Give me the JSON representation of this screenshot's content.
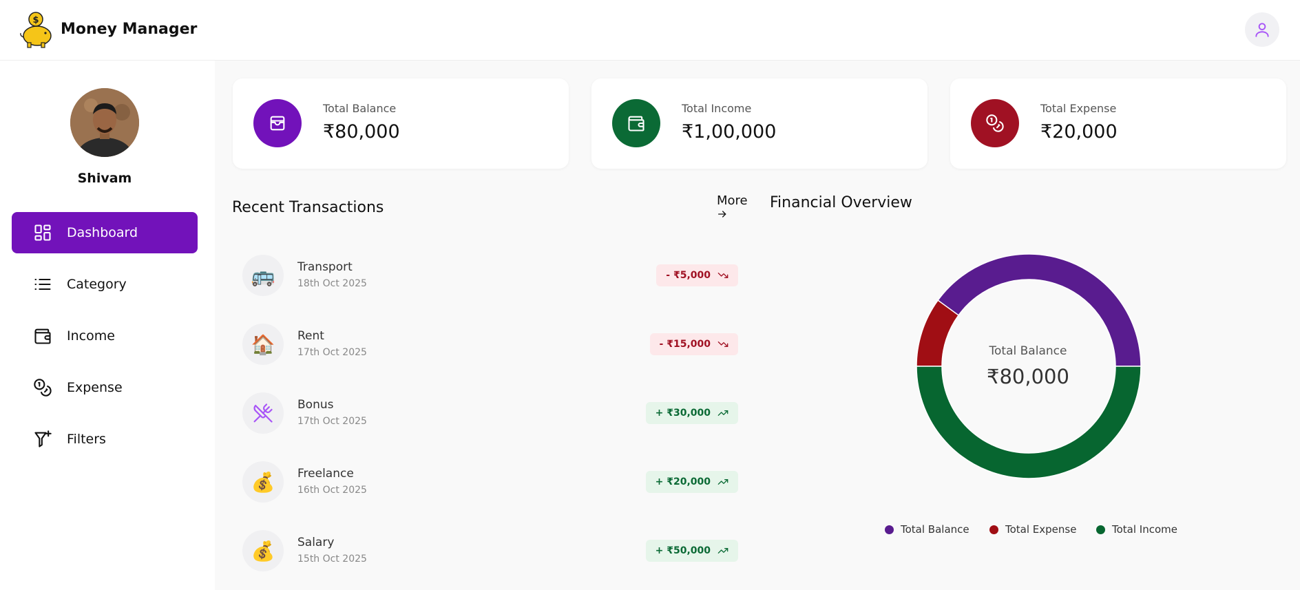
{
  "header": {
    "app_title": "Money Manager"
  },
  "sidebar": {
    "user_name": "Shivam",
    "items": [
      {
        "label": "Dashboard",
        "icon": "dashboard-icon",
        "active": true
      },
      {
        "label": "Category",
        "icon": "list-icon"
      },
      {
        "label": "Income",
        "icon": "wallet-icon"
      },
      {
        "label": "Expense",
        "icon": "coins-icon"
      },
      {
        "label": "Filters",
        "icon": "filter-plus-icon"
      }
    ]
  },
  "cards": [
    {
      "label": "Total Balance",
      "value": "₹80,000",
      "color": "#7212ba",
      "icon": "wallet-card-icon"
    },
    {
      "label": "Total Income",
      "value": "₹1,00,000",
      "color": "#0b6a35",
      "icon": "wallet-icon"
    },
    {
      "label": "Total Expense",
      "value": "₹20,000",
      "color": "#a01123",
      "icon": "coins-icon"
    }
  ],
  "transactions": {
    "title": "Recent Transactions",
    "more_label": "More",
    "items": [
      {
        "name": "Transport",
        "date": "18th Oct 2025",
        "amount": "- ₹5,000",
        "type": "expense",
        "icon": "🚌"
      },
      {
        "name": "Rent",
        "date": "17th Oct 2025",
        "amount": "- ₹15,000",
        "type": "expense",
        "icon": "🏠"
      },
      {
        "name": "Bonus",
        "date": "17th Oct 2025",
        "amount": "+ ₹30,000",
        "type": "income",
        "icon": "utensils-icon"
      },
      {
        "name": "Freelance",
        "date": "16th Oct 2025",
        "amount": "+ ₹20,000",
        "type": "income",
        "icon": "💰"
      },
      {
        "name": "Salary",
        "date": "15th Oct 2025",
        "amount": "+ ₹50,000",
        "type": "income",
        "icon": "💰"
      }
    ]
  },
  "overview": {
    "title": "Financial Overview",
    "center_label": "Total Balance",
    "center_value": "₹80,000"
  },
  "chart_data": {
    "type": "pie",
    "categories": [
      "Total Balance",
      "Total Expense",
      "Total Income"
    ],
    "values": [
      80000,
      20000,
      100000
    ],
    "colors": [
      "#591c8f",
      "#a00e14",
      "#076630"
    ],
    "title": "",
    "legend_position": "bottom"
  }
}
